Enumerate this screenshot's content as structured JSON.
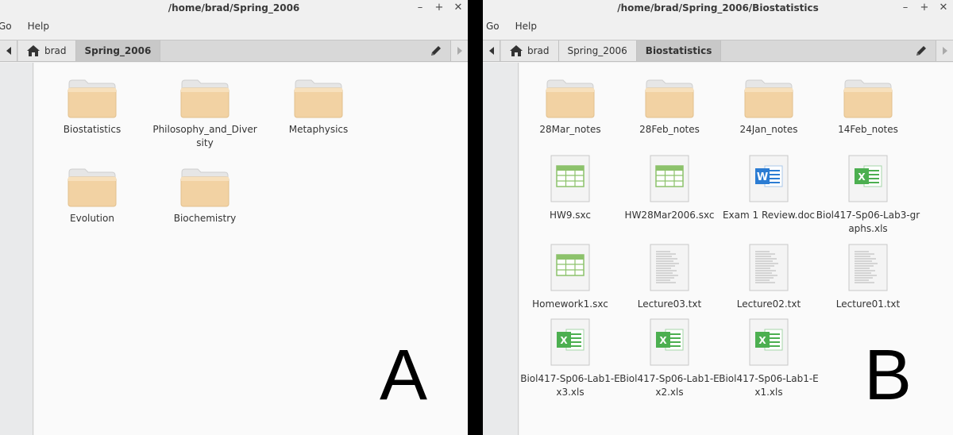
{
  "windowA": {
    "title": "/home/brad/Spring_2006",
    "menu": [
      "Go",
      "Help"
    ],
    "crumbs": [
      "brad",
      "Spring_2006"
    ],
    "active_crumb": "Spring_2006",
    "items": [
      {
        "name": "Biostatistics",
        "type": "folder"
      },
      {
        "name": "Philosophy_and_Diversity",
        "type": "folder"
      },
      {
        "name": "Metaphysics",
        "type": "folder"
      },
      {
        "name": "Evolution",
        "type": "folder"
      },
      {
        "name": "Biochemistry",
        "type": "folder"
      }
    ],
    "panel_label": "A"
  },
  "windowB": {
    "title": "/home/brad/Spring_2006/Biostatistics",
    "menu": [
      "Go",
      "Help"
    ],
    "crumbs": [
      "brad",
      "Spring_2006",
      "Biostatistics"
    ],
    "active_crumb": "Biostatistics",
    "items": [
      {
        "name": "28Mar_notes",
        "type": "folder"
      },
      {
        "name": "28Feb_notes",
        "type": "folder"
      },
      {
        "name": "24Jan_notes",
        "type": "folder"
      },
      {
        "name": "14Feb_notes",
        "type": "folder"
      },
      {
        "name": "HW9.sxc",
        "type": "spreadsheet-sxc"
      },
      {
        "name": "HW28Mar2006.sxc",
        "type": "spreadsheet-sxc"
      },
      {
        "name": "Exam 1 Review.doc",
        "type": "word-doc"
      },
      {
        "name": "Biol417-Sp06-Lab3-graphs.xls",
        "type": "excel-xls"
      },
      {
        "name": "Homework1.sxc",
        "type": "spreadsheet-sxc"
      },
      {
        "name": "Lecture03.txt",
        "type": "text"
      },
      {
        "name": "Lecture02.txt",
        "type": "text"
      },
      {
        "name": "Lecture01.txt",
        "type": "text"
      },
      {
        "name": "Biol417-Sp06-Lab1-Ex3.xls",
        "type": "excel-xls"
      },
      {
        "name": "Biol417-Sp06-Lab1-Ex2.xls",
        "type": "excel-xls"
      },
      {
        "name": "Biol417-Sp06-Lab1-Ex1.xls",
        "type": "excel-xls"
      }
    ],
    "panel_label": "B"
  },
  "window_controls": [
    "minimize-icon",
    "maximize-icon",
    "close-icon"
  ],
  "colors": {
    "folder": "#f2d2a3",
    "folder_tab": "#e6e6e6",
    "spreadsheet_green": "#8cc26b",
    "word_blue": "#2b7cd3",
    "excel_green": "#4caf50"
  }
}
